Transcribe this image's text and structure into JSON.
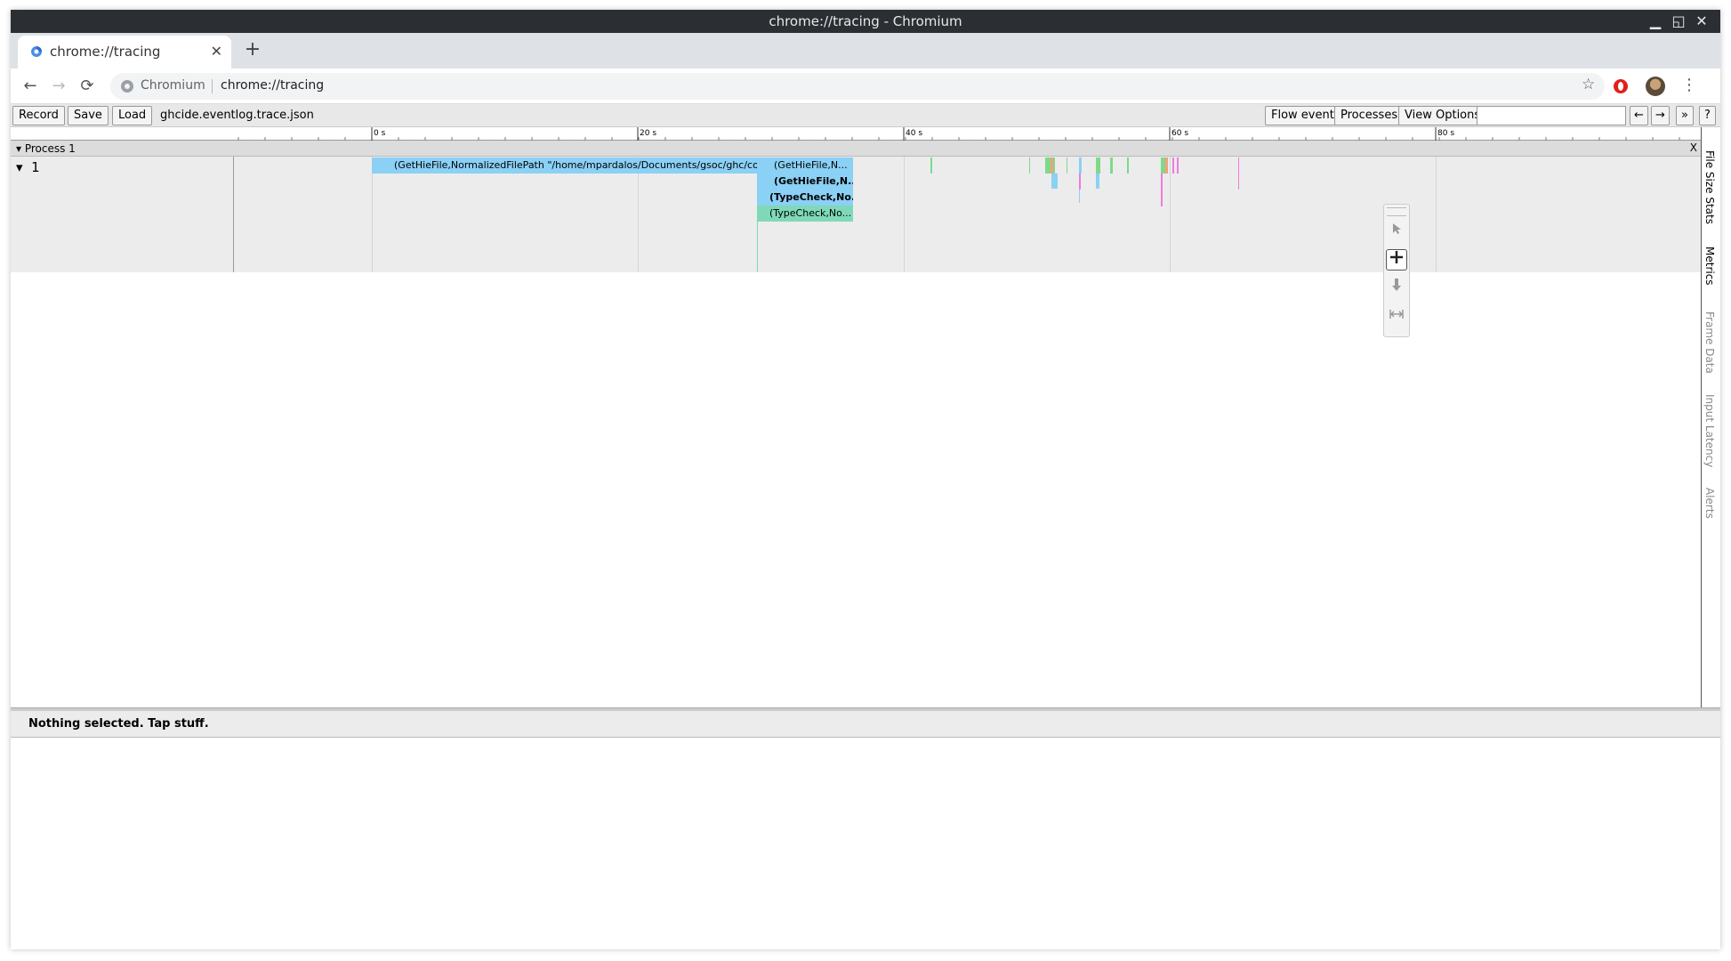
{
  "window": {
    "title": "chrome://tracing - Chromium",
    "controls": {
      "minimize": "▁",
      "maximize": "◱",
      "close": "✕"
    }
  },
  "tabstrip": {
    "tabs": [
      {
        "title": "chrome://tracing",
        "close": "✕"
      }
    ],
    "new_tab": "+"
  },
  "omnibar": {
    "back": "←",
    "forward": "→",
    "reload": "⟳",
    "site_name": "Chromium",
    "url": "chrome://tracing",
    "bookmark": "☆",
    "menu": "⋮"
  },
  "toolbar": {
    "record_label": "Record",
    "save_label": "Save",
    "load_label": "Load",
    "filename": "ghcide.eventlog.trace.json",
    "flow_events_label": "Flow events",
    "processes_label": "Processes",
    "view_options_label": "View Options",
    "search_value": "",
    "prev_label": "←",
    "next_label": "→",
    "more_label": "»",
    "help_label": "?"
  },
  "ruler": {
    "ticks": [
      "0 s",
      "20 s",
      "40 s",
      "60 s",
      "80 s"
    ]
  },
  "process": {
    "label": "Process 1",
    "close": "X",
    "thread_label": "1",
    "slices": [
      {
        "text": "(GetHieFile,NormalizedFilePath \"/home/mpardalos/Documents/gsoc/ghc/comp...",
        "color": "#8bd0f5"
      },
      {
        "text": "(GetHieFile,N...",
        "color": "#8bd0f5"
      },
      {
        "text": "(GetHieFile,N...",
        "color": "#8bd0f5"
      },
      {
        "text": "(TypeCheck,No...",
        "color": "#8bd0f5"
      },
      {
        "text": "(TypeCheck,No...",
        "color": "#7fd9b8"
      }
    ]
  },
  "mouse_modes": {
    "selection": "selection-icon",
    "pan": "pan-icon",
    "zoom": "zoom-icon",
    "timing": "timing-icon"
  },
  "side_tabs": [
    "File Size Stats",
    "Metrics",
    "Frame Data",
    "Input Latency",
    "Alerts"
  ],
  "analysis": {
    "status": "Nothing selected. Tap stuff."
  }
}
